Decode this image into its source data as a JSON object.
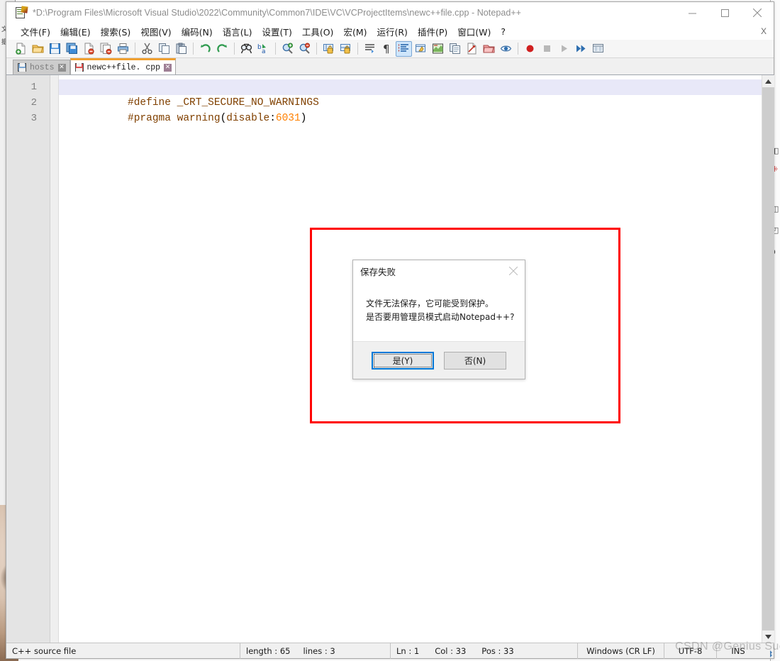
{
  "window": {
    "title": "*D:\\Program Files\\Microsoft Visual Studio\\2022\\Community\\Common7\\IDE\\VC\\VCProjectItems\\newc++file.cpp - Notepad++",
    "app_icon": "notepad-plus-plus-icon",
    "controls": {
      "minimize": "minimize-icon",
      "maximize": "maximize-icon",
      "close": "close-icon"
    }
  },
  "menubar": {
    "items": [
      {
        "label": "文件(F)",
        "name": "menu-file"
      },
      {
        "label": "编辑(E)",
        "name": "menu-edit"
      },
      {
        "label": "搜索(S)",
        "name": "menu-search"
      },
      {
        "label": "视图(V)",
        "name": "menu-view"
      },
      {
        "label": "编码(N)",
        "name": "menu-encoding"
      },
      {
        "label": "语言(L)",
        "name": "menu-language"
      },
      {
        "label": "设置(T)",
        "name": "menu-settings"
      },
      {
        "label": "工具(O)",
        "name": "menu-tools"
      },
      {
        "label": "宏(M)",
        "name": "menu-macro"
      },
      {
        "label": "运行(R)",
        "name": "menu-run"
      },
      {
        "label": "插件(P)",
        "name": "menu-plugins"
      },
      {
        "label": "窗口(W)",
        "name": "menu-window"
      },
      {
        "label": "?",
        "name": "menu-help"
      }
    ],
    "close_doc_label": "X"
  },
  "toolbar": {
    "buttons": [
      "new-file-icon",
      "open-file-icon",
      "save-icon",
      "save-all-icon",
      "close-file-icon",
      "close-all-icon",
      "print-icon",
      "|",
      "cut-icon",
      "copy-icon",
      "paste-icon",
      "|",
      "undo-icon",
      "redo-icon",
      "|",
      "find-icon",
      "replace-icon",
      "|",
      "zoom-in-icon",
      "zoom-out-icon",
      "|",
      "sync-vertical-icon",
      "sync-horizontal-icon",
      "|",
      "word-wrap-icon",
      "show-all-chars-icon",
      "indent-guide-icon",
      "user-defined-language-icon",
      "document-map-icon",
      "document-list-icon",
      "function-list-icon",
      "folder-as-workspace-icon",
      "monitor-icon",
      "|",
      "record-macro-icon",
      "stop-macro-icon",
      "play-macro-icon",
      "play-multiple-icon",
      "save-macro-icon"
    ],
    "active_button": "indent-guide-icon"
  },
  "tabs": [
    {
      "label": "hosts",
      "active": false,
      "name": "tab-hosts",
      "close": "✕"
    },
    {
      "label": "newc++file. cpp",
      "active": true,
      "name": "tab-newcppfile",
      "close": "✕"
    }
  ],
  "editor": {
    "line_numbers": [
      "1",
      "2",
      "3"
    ],
    "lines": [
      {
        "number": "1",
        "current": true,
        "tokens": [
          {
            "text": "#define",
            "color": "#804000"
          },
          {
            "text": " _CRT_SECURE_NO_WARNINGS",
            "color": "#804000"
          }
        ]
      },
      {
        "number": "2",
        "current": false,
        "tokens": [
          {
            "text": "#pragma",
            "color": "#804000"
          },
          {
            "text": " warning",
            "color": "#804000"
          },
          {
            "text": "(",
            "color": "#000000"
          },
          {
            "text": "disable",
            "color": "#804000"
          },
          {
            "text": ":",
            "color": "#000000"
          },
          {
            "text": "6031",
            "color": "#ff8000"
          },
          {
            "text": ")",
            "color": "#000000"
          }
        ]
      },
      {
        "number": "3",
        "current": false,
        "tokens": []
      }
    ],
    "scroll_up_icon": "scroll-up-arrow-icon",
    "scroll_down_icon": "scroll-down-arrow-icon"
  },
  "statusbar": {
    "file_type": "C++ source file",
    "length_label": "length : 65",
    "lines_label": "lines : 3",
    "ln": "Ln : 1",
    "col": "Col : 33",
    "pos": "Pos : 33",
    "eol": "Windows (CR LF)",
    "encoding": "UTF-8",
    "insert_mode": "INS"
  },
  "dialog": {
    "title": "保存失败",
    "close_icon": "close-icon",
    "message_lines": [
      "文件无法保存，它可能受到保护。",
      "是否要用管理员模式启动Notepad++?"
    ],
    "buttons": [
      {
        "label": "是(Y)",
        "mnemonic": "Y",
        "prefix": "是(",
        "suffix": ")",
        "default": true,
        "name": "yes-button"
      },
      {
        "label": "否(N)",
        "mnemonic": "N",
        "prefix": "否(",
        "suffix": ")",
        "default": false,
        "name": "no-button"
      }
    ]
  },
  "annotation": {
    "shape": "rectangle",
    "color": "#ff0000",
    "stroke_width": 3
  },
  "watermark": {
    "text": "CSDN @Genius Sue:"
  },
  "colors": {
    "accent": "#0078d7",
    "annotation_red": "#ff0000",
    "active_tab_top": "#f0a030",
    "preprocessor": "#804000",
    "number": "#ff8000",
    "current_line_bg": "#e8e8f8"
  }
}
